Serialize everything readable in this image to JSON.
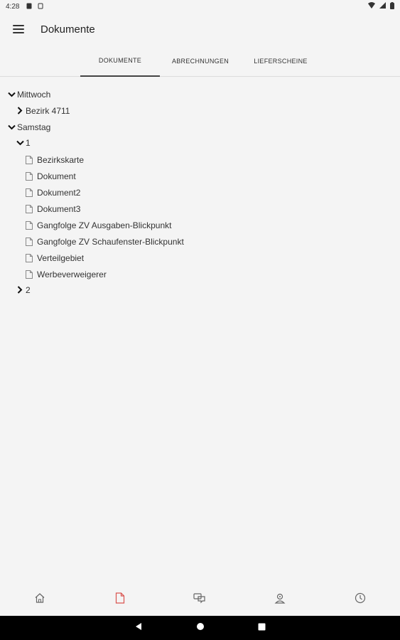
{
  "status": {
    "time": "4:28"
  },
  "app_bar": {
    "title": "Dokumente"
  },
  "tabs": [
    {
      "label": "DOKUMENTE",
      "active": true
    },
    {
      "label": "ABRECHNUNGEN",
      "active": false
    },
    {
      "label": "LIEFERSCHEINE",
      "active": false
    }
  ],
  "tree": {
    "mittwoch": {
      "label": "Mittwoch",
      "expanded": true
    },
    "bezirk": {
      "label": "Bezirk 4711",
      "expanded": false
    },
    "samstag": {
      "label": "Samstag",
      "expanded": true
    },
    "group1": {
      "label": "1",
      "expanded": true
    },
    "docs": [
      "Bezirkskarte",
      "Dokument",
      "Dokument2",
      "Dokument3",
      "Gangfolge ZV Ausgaben-Blickpunkt",
      "Gangfolge ZV Schaufenster-Blickpunkt",
      "Verteilgebiet",
      "Werbeverweigerer"
    ],
    "group2": {
      "label": "2",
      "expanded": false
    }
  },
  "bottom_nav": {
    "items": [
      "home-icon",
      "document-icon",
      "chat-icon",
      "person-icon",
      "clock-icon"
    ],
    "active_color": "#d9534f",
    "inactive_color": "#666666"
  }
}
